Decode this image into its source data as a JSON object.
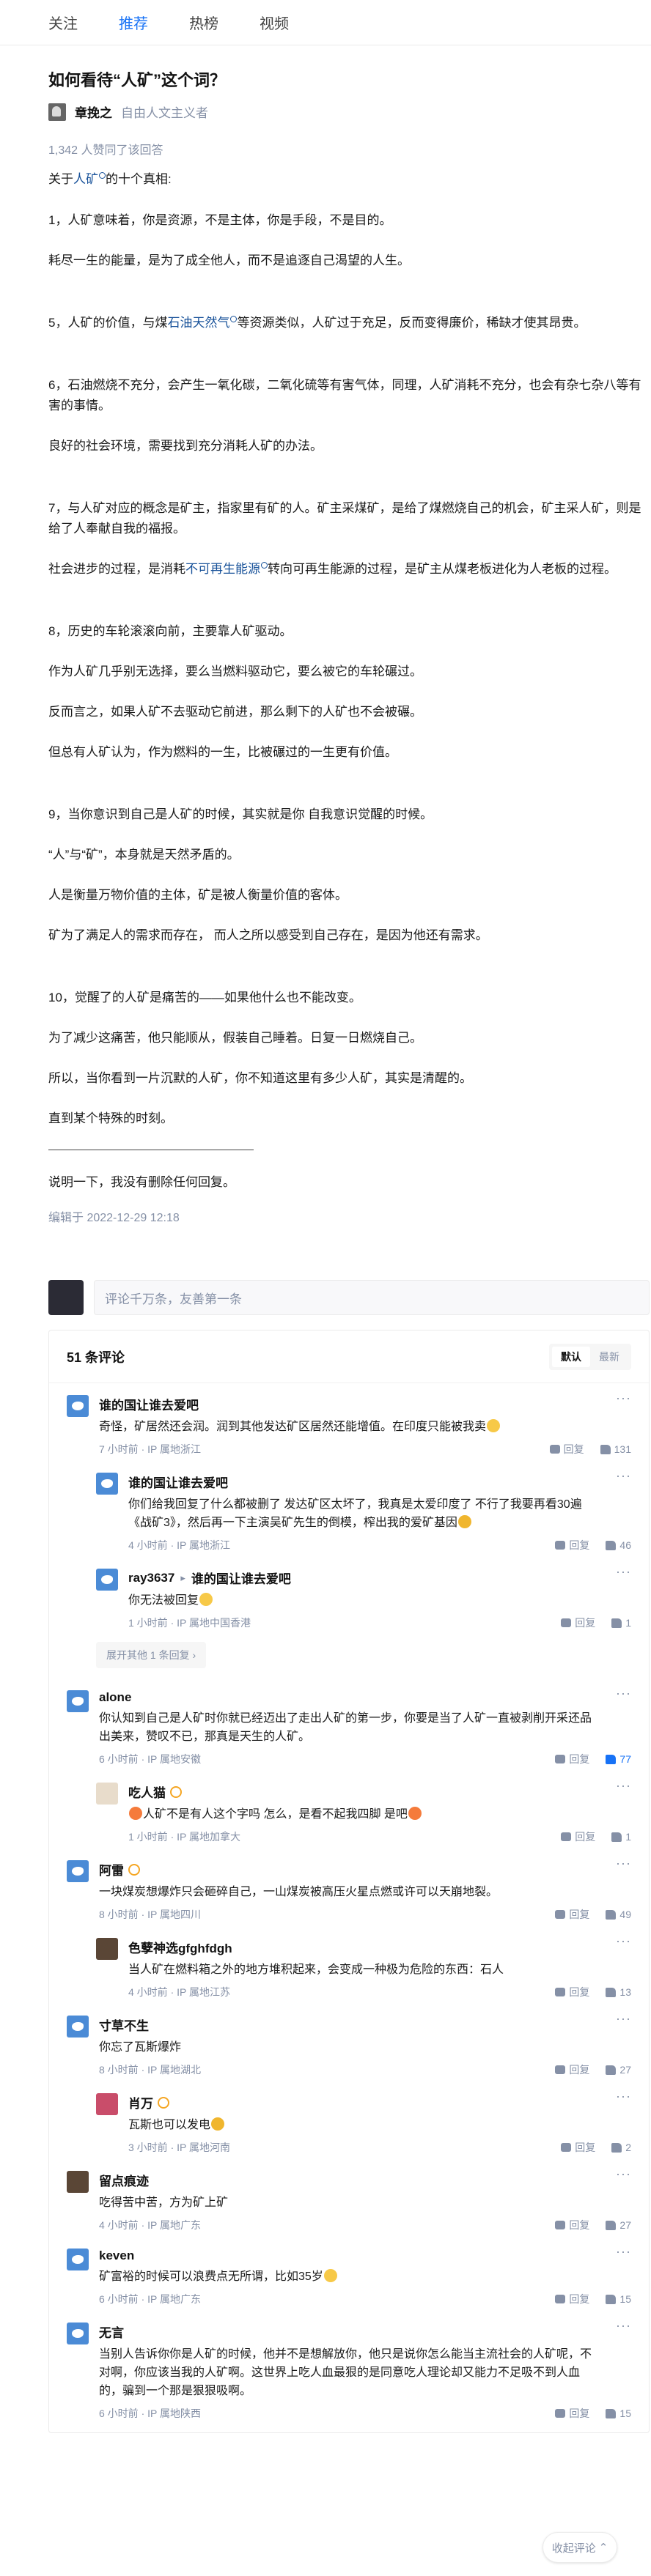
{
  "nav": {
    "tabs": [
      "关注",
      "推荐",
      "热榜",
      "视频"
    ],
    "active_tab": "推荐"
  },
  "question": {
    "title": "如何看待“人矿”这个词？"
  },
  "author": {
    "name": "章挽之",
    "bio": "自由人文主义者"
  },
  "answer": {
    "agree": "1,342 人赞同了该回答",
    "intro_pre": "关于",
    "intro_link": "人矿",
    "intro_post": "的十个真相:",
    "p1": "1，人矿意味着，你是资源，不是主体，你是手段，不是目的。",
    "p1b": "耗尽一生的能量，是为了成全他人，而不是追逐自己渴望的人生。",
    "p5_pre": "5，人矿的价值，与煤",
    "p5_link": "石油天然气",
    "p5_post": "等资源类似，人矿过于充足，反而变得廉价，稀缺才使其昂贵。",
    "p6": "6，石油燃烧不充分，会产生一氧化碳，二氧化硫等有害气体，同理，人矿消耗不充分，也会有杂七杂八等有害的事情。",
    "p6b": "良好的社会环境，需要找到充分消耗人矿的办法。",
    "p7": "7，与人矿对应的概念是矿主，指家里有矿的人。矿主采煤矿，是给了煤燃烧自己的机会，矿主采人矿，则是给了人奉献自我的福报。",
    "p7b_pre": "社会进步的过程，是消耗",
    "p7b_link": "不可再生能源",
    "p7b_post": "转向可再生能源的过程，是矿主从煤老板进化为人老板的过程。",
    "p8": "8，历史的车轮滚滚向前，主要靠人矿驱动。",
    "p8b": "作为人矿几乎别无选择，要么当燃料驱动它，要么被它的车轮碾过。",
    "p8c": "反而言之，如果人矿不去驱动它前进，那么剩下的人矿也不会被碾。",
    "p8d": "但总有人矿认为，作为燃料的一生，比被碾过的一生更有价值。",
    "p9": "9，当你意识到自己是人矿的时候，其实就是你 自我意识觉醒的时候。",
    "p9b": "“人”与“矿”，本身就是天然矛盾的。",
    "p9c": "人是衡量万物价值的主体，矿是被人衡量价值的客体。",
    "p9d": "矿为了满足人的需求而存在， 而人之所以感受到自己存在，是因为他还有需求。",
    "p10": "10，觉醒了的人矿是痛苦的——如果他什么也不能改变。",
    "p10b": "为了减少这痛苦，他只能顺从，假装自己睡着。日复一日燃烧自己。",
    "p10c": "所以，当你看到一片沉默的人矿，你不知道这里有多少人矿，其实是清醒的。",
    "p10d": "直到某个特殊的时刻。",
    "note": "说明一下，我没有删除任何回复。",
    "edited": "编辑于 2022-12-29 12:18"
  },
  "comment_box": {
    "placeholder": "评论千万条，友善第一条"
  },
  "comments": {
    "count_label": "51 条评论",
    "sort_default": "默认",
    "sort_latest": "最新",
    "reply_label": "回复",
    "expand_label": "展开其他 1 条回复",
    "collapse_label": "收起评论",
    "items": [
      {
        "user": "谁的国让谁去爱吧",
        "text": "奇怪，矿居然还会润。润到其他发达矿区居然还能增值。在印度只能被我卖",
        "meta": "7 小时前 · IP 属地浙江",
        "likes": "131"
      },
      {
        "user": "谁的国让谁去爱吧",
        "text": "你们给我回复了什么都被删了 发达矿区太坏了，我真是太爱印度了 不行了我要再看30遍《战矿3》，然后再一下主演吴矿先生的倒模，榨出我的爱矿基因",
        "meta": "4 小时前 · IP 属地浙江",
        "likes": "46"
      },
      {
        "user": "ray3637",
        "reply_to": "谁的国让谁去爱吧",
        "text": "你无法被回复",
        "meta": "1 小时前 · IP 属地中国香港",
        "likes": "1"
      },
      {
        "user": "alone",
        "text": "你认知到自己是人矿时你就已经迈出了走出人矿的第一步，你要是当了人矿一直被剥削开采还品出美来，赞叹不已，那真是天生的人矿。",
        "meta": "6 小时前 · IP 属地安徽",
        "likes": "77"
      },
      {
        "user": "吃人猫",
        "text": "人矿不是有人这个字吗 怎么，是看不起我四脚 是吧",
        "meta": "1 小时前 · IP 属地加拿大",
        "likes": "1"
      },
      {
        "user": "阿雷",
        "text": "一块煤炭想爆炸只会砸碎自己，一山煤炭被高压火星点燃或许可以天崩地裂。",
        "meta": "8 小时前 · IP 属地四川",
        "likes": "49"
      },
      {
        "user": "色孽神选gfghfdgh",
        "text": "当人矿在燃料箱之外的地方堆积起来，会变成一种极为危险的东西：石人",
        "meta": "4 小时前 · IP 属地江苏",
        "likes": "13"
      },
      {
        "user": "寸草不生",
        "text": "你忘了瓦斯爆炸",
        "meta": "8 小时前 · IP 属地湖北",
        "likes": "27"
      },
      {
        "user": "肖万",
        "text": "瓦斯也可以发电",
        "meta": "3 小时前 · IP 属地河南",
        "likes": "2"
      },
      {
        "user": "留点痕迹",
        "text": "吃得苦中苦，方为矿上矿",
        "meta": "4 小时前 · IP 属地广东",
        "likes": "27"
      },
      {
        "user": "keven",
        "text": "矿富裕的时候可以浪费点无所谓，比如35岁",
        "meta": "6 小时前 · IP 属地广东",
        "likes": "15"
      },
      {
        "user": "无言",
        "text": "当别人告诉你你是人矿的时候，他并不是想解放你，他只是说你怎么能当主流社会的人矿呢，不对啊，你应该当我的人矿啊。这世界上吃人血最狠的是同意吃人理论却又能力不足吸不到人血的，骗到一个那是狠狠吸啊。",
        "meta": "6 小时前 · IP 属地陕西",
        "likes": "15"
      }
    ]
  }
}
